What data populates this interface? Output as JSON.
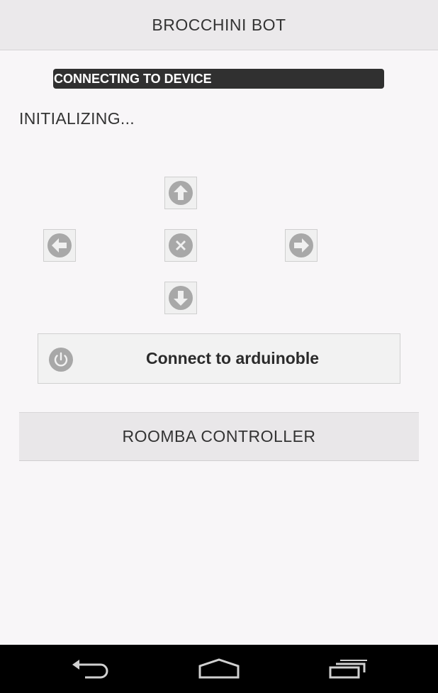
{
  "app": {
    "title": "BROCCHINI BOT"
  },
  "status": {
    "toast": "CONNECTING TO DEVICE",
    "message": "INITIALIZING..."
  },
  "dpad": {
    "up_icon": "arrow-up-circle-icon",
    "left_icon": "arrow-left-circle-icon",
    "stop_icon": "close-circle-icon",
    "right_icon": "arrow-right-circle-icon",
    "down_icon": "arrow-down-circle-icon"
  },
  "connect": {
    "label": "Connect to arduinoble",
    "icon": "power-icon"
  },
  "roomba": {
    "label": "ROOMBA CONTROLLER"
  },
  "navbar": {
    "back_icon": "back-icon",
    "home_icon": "home-icon",
    "recents_icon": "recents-icon"
  },
  "colors": {
    "background": "#f8f6f8",
    "titlebar": "#ebe9eb",
    "toast": "#303030",
    "icon_gray": "#a8a8a8",
    "navbar": "#000000"
  }
}
